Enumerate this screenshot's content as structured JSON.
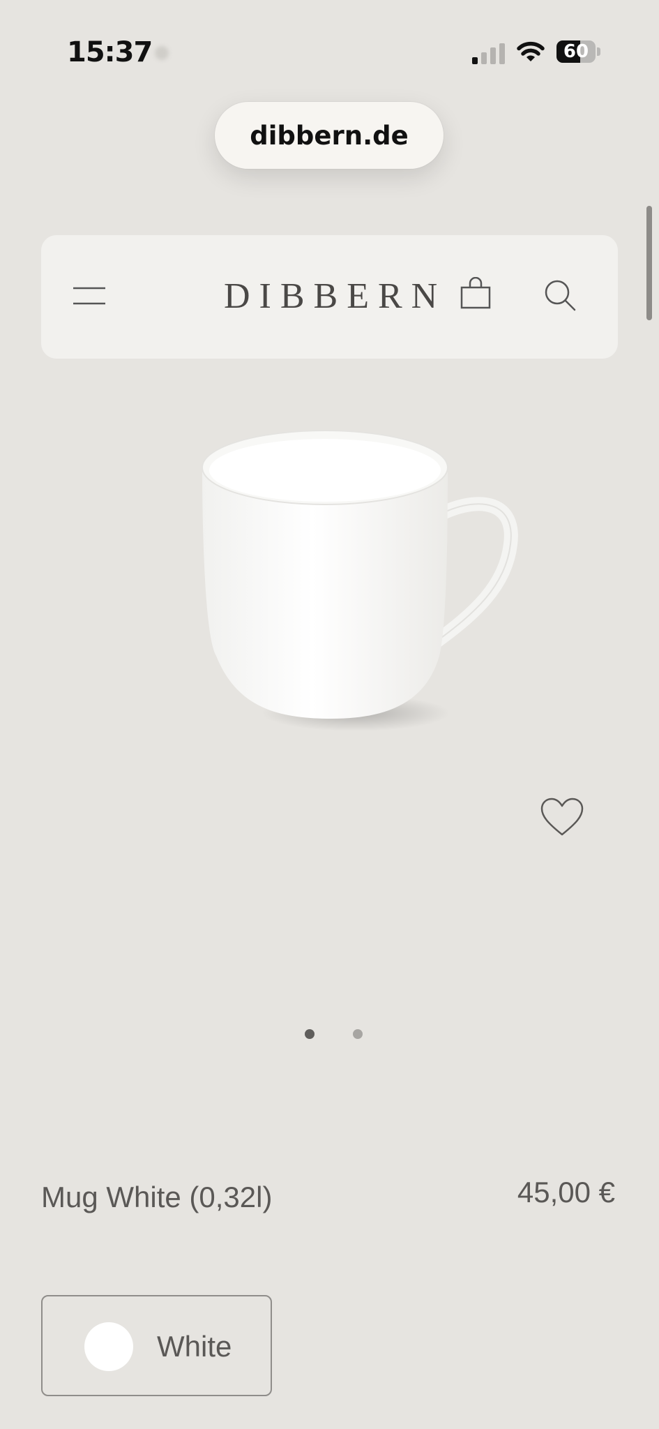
{
  "status_bar": {
    "time": "15:37",
    "battery_level": "60",
    "battery_fraction": 0.6,
    "icons": [
      "signal-icon",
      "wifi-icon",
      "battery-icon"
    ]
  },
  "browser": {
    "url": "dibbern.de"
  },
  "header": {
    "logo": "DIBBERN",
    "icons": [
      "menu-icon",
      "shopping-bag-icon",
      "search-icon"
    ]
  },
  "gallery": {
    "image": "white-mug",
    "slide_count": 2,
    "active_slide": 1,
    "wishlist_icon": "heart-icon"
  },
  "product": {
    "name": "Mug White (0,32l)",
    "price": "45,00 €"
  },
  "variant": {
    "label": "White",
    "swatch_color": "#ffffff"
  },
  "colors": {
    "background": "#e6e4e0",
    "header_background": "#f2f1ee",
    "text": "#5a5856"
  }
}
